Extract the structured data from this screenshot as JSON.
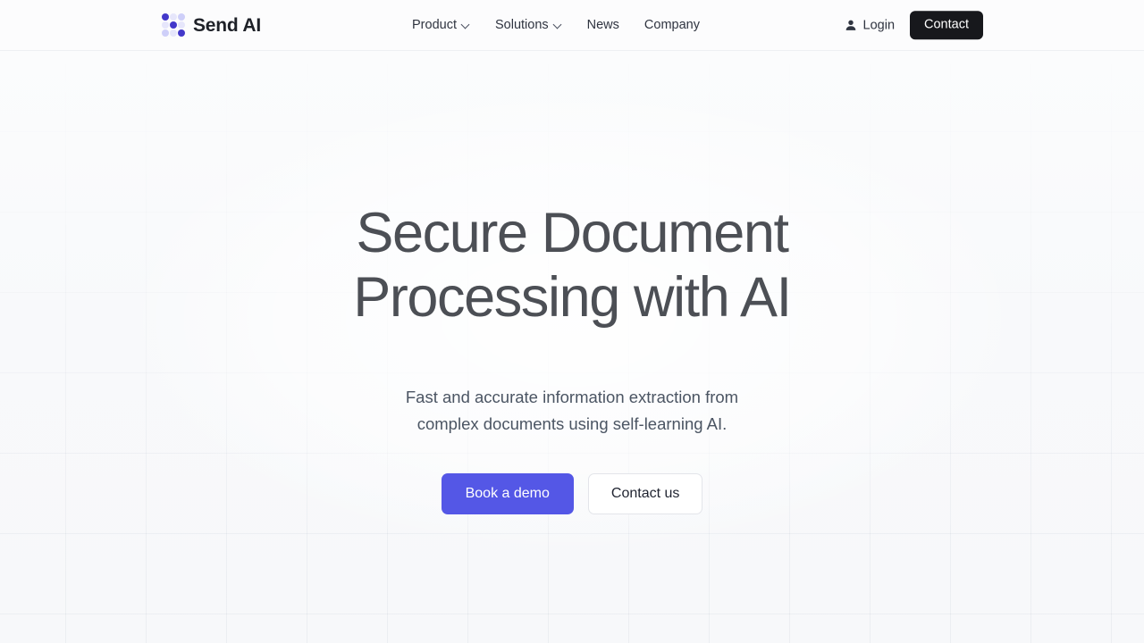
{
  "header": {
    "brand": {
      "name": "Send AI",
      "logo_icon": "send-ai-dot-grid-logo",
      "accent_color": "#4338ca"
    },
    "nav": [
      {
        "label": "Product",
        "has_dropdown": true,
        "icon": "chevron-down-icon"
      },
      {
        "label": "Solutions",
        "has_dropdown": true,
        "icon": "chevron-down-icon"
      },
      {
        "label": "News",
        "has_dropdown": false,
        "icon": ""
      },
      {
        "label": "Company",
        "has_dropdown": false,
        "icon": ""
      }
    ],
    "login": {
      "label": "Login",
      "icon": "user-icon"
    },
    "contact_button": {
      "label": "Contact",
      "background": "#17181c",
      "color": "#ffffff"
    }
  },
  "hero": {
    "title_line_1": "Secure Document",
    "title_line_2": "Processing with AI",
    "subtitle_line_1": "Fast and accurate information extraction from",
    "subtitle_line_2": "complex documents using self-learning AI.",
    "primary_cta": {
      "label": "Book a demo",
      "background": "#5457e6",
      "color": "#ffffff"
    },
    "secondary_cta": {
      "label": "Contact us",
      "background": "#ffffff",
      "color": "#1f2330"
    }
  },
  "theme": {
    "page_background": "#f8f9fb",
    "header_background": "#fcfcfd",
    "heading_color": "#4c4f55",
    "body_text_color": "#4b5563",
    "brand_purple": "#5457e6",
    "grid_line_color": "#64748b"
  }
}
